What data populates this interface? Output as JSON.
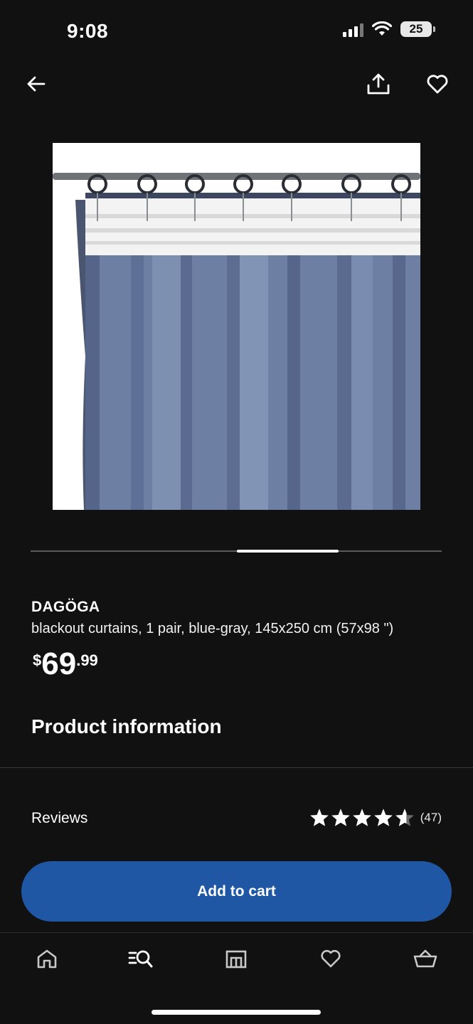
{
  "status_bar": {
    "time": "9:08",
    "battery": "25"
  },
  "header": {
    "back_icon": "arrow-left-icon",
    "share_icon": "share-icon",
    "favorite_icon": "heart-icon"
  },
  "product": {
    "brand": "DAGÖGA",
    "description": "blackout curtains, 1 pair, blue-gray, 145x250 cm (57x98 \")",
    "price": {
      "currency": "$",
      "integer": "69",
      "decimal": ".99"
    },
    "image_icon": "curtain-product-image"
  },
  "carousel": {
    "active_index": 3,
    "total": 4
  },
  "sections": {
    "product_info": "Product information"
  },
  "reviews": {
    "label": "Reviews",
    "rating": 4.5,
    "count": "(47)"
  },
  "actions": {
    "add_to_cart": "Add to cart"
  },
  "tab_bar": {
    "items": [
      {
        "icon": "home-icon"
      },
      {
        "icon": "search-list-icon"
      },
      {
        "icon": "store-icon"
      },
      {
        "icon": "heart-icon"
      },
      {
        "icon": "basket-icon"
      }
    ]
  },
  "colors": {
    "background": "#111112",
    "accent": "#1f57a5"
  }
}
